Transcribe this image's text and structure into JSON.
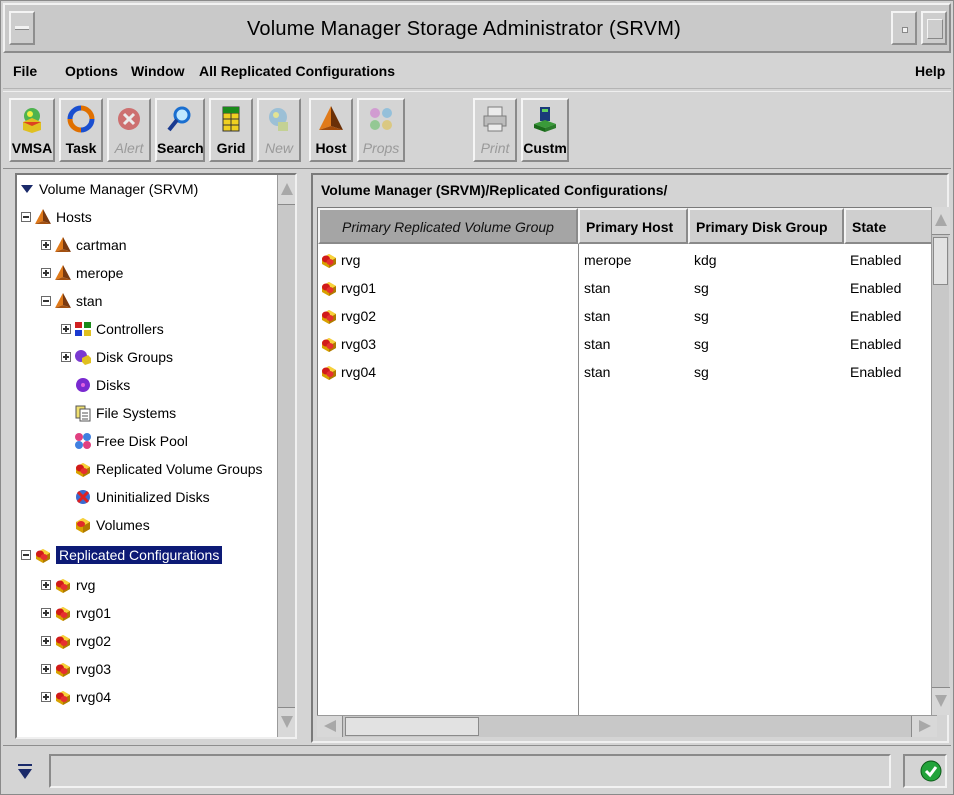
{
  "window": {
    "title": "Volume Manager Storage Administrator (SRVM)"
  },
  "menubar": {
    "file": "File",
    "options": "Options",
    "window": "Window",
    "all_replicated": "All Replicated Configurations",
    "help": "Help"
  },
  "toolbar": {
    "buttons": [
      {
        "label": "VMSA",
        "icon": "vmsa-icon",
        "enabled": true
      },
      {
        "label": "Task",
        "icon": "task-icon",
        "enabled": true
      },
      {
        "label": "Alert",
        "icon": "alert-icon",
        "enabled": false
      },
      {
        "label": "Search",
        "icon": "search-icon",
        "enabled": true
      },
      {
        "label": "Grid",
        "icon": "grid-icon",
        "enabled": true
      },
      {
        "label": "New",
        "icon": "new-icon",
        "enabled": false
      },
      {
        "label": "Host",
        "icon": "host-icon",
        "enabled": true
      },
      {
        "label": "Props",
        "icon": "props-icon",
        "enabled": false
      },
      {
        "label": "Print",
        "icon": "print-icon",
        "enabled": false
      },
      {
        "label": "Custm",
        "icon": "custom-icon",
        "enabled": true
      }
    ]
  },
  "tree": {
    "root": "Volume Manager (SRVM)",
    "hosts": "Hosts",
    "host_items": [
      "cartman",
      "merope",
      "stan"
    ],
    "stan_children": [
      "Controllers",
      "Disk Groups",
      "Disks",
      "File Systems",
      "Free Disk Pool",
      "Replicated Volume Groups",
      "Uninitialized Disks",
      "Volumes"
    ],
    "replicated": "Replicated Configurations",
    "replicated_items": [
      "rvg",
      "rvg01",
      "rvg02",
      "rvg03",
      "rvg04"
    ]
  },
  "main": {
    "path": "Volume Manager (SRVM)/Replicated Configurations/",
    "columns": [
      "Primary Replicated Volume Group",
      "Primary Host",
      "Primary Disk Group",
      "State"
    ],
    "rows": [
      [
        "rvg",
        "merope",
        "kdg",
        "Enabled"
      ],
      [
        "rvg01",
        "stan",
        "sg",
        "Enabled"
      ],
      [
        "rvg02",
        "stan",
        "sg",
        "Enabled"
      ],
      [
        "rvg03",
        "stan",
        "sg",
        "Enabled"
      ],
      [
        "rvg04",
        "stan",
        "sg",
        "Enabled"
      ]
    ]
  },
  "colors": {
    "selection": "#0d1a76",
    "window_bg": "#d4d4d4",
    "status_ok": "#22a33a"
  }
}
